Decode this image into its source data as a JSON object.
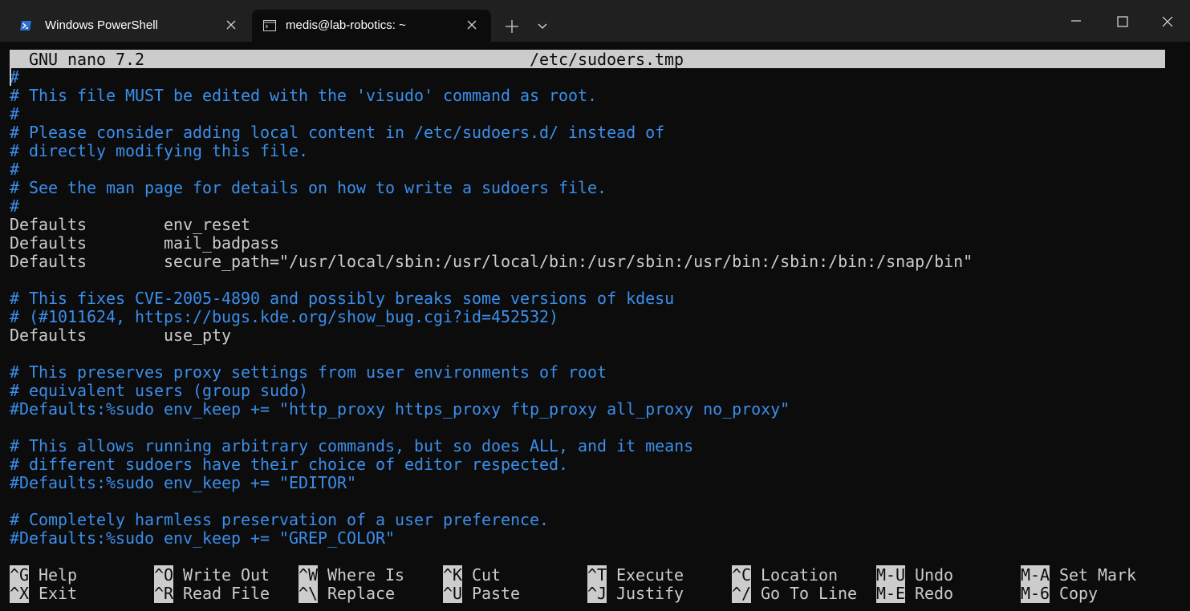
{
  "window": {
    "tabs": [
      {
        "label": "Windows PowerShell",
        "icon": "powershell-icon",
        "active": false
      },
      {
        "label": "medis@lab-robotics: ~",
        "icon": "terminal-icon",
        "active": true
      }
    ],
    "new_tab_icon": "plus-icon",
    "dropdown_icon": "chevron-down-icon",
    "controls": [
      "minimize-icon",
      "maximize-icon",
      "close-icon"
    ]
  },
  "editor": {
    "app": "GNU nano 7.2",
    "filename": "/etc/sudoers.tmp",
    "lines": [
      {
        "text": "#",
        "kind": "comment"
      },
      {
        "text": "# This file MUST be edited with the 'visudo' command as root.",
        "kind": "comment"
      },
      {
        "text": "#",
        "kind": "comment"
      },
      {
        "text": "# Please consider adding local content in /etc/sudoers.d/ instead of",
        "kind": "comment"
      },
      {
        "text": "# directly modifying this file.",
        "kind": "comment"
      },
      {
        "text": "#",
        "kind": "comment"
      },
      {
        "text": "# See the man page for details on how to write a sudoers file.",
        "kind": "comment"
      },
      {
        "text": "#",
        "kind": "comment"
      },
      {
        "text": "Defaults        env_reset",
        "kind": "normal"
      },
      {
        "text": "Defaults        mail_badpass",
        "kind": "normal"
      },
      {
        "text": "Defaults        secure_path=\"/usr/local/sbin:/usr/local/bin:/usr/sbin:/usr/bin:/sbin:/bin:/snap/bin\"",
        "kind": "normal"
      },
      {
        "text": "",
        "kind": "normal"
      },
      {
        "text": "# This fixes CVE-2005-4890 and possibly breaks some versions of kdesu",
        "kind": "comment"
      },
      {
        "text": "# (#1011624, https://bugs.kde.org/show_bug.cgi?id=452532)",
        "kind": "comment"
      },
      {
        "text": "Defaults        use_pty",
        "kind": "normal"
      },
      {
        "text": "",
        "kind": "normal"
      },
      {
        "text": "# This preserves proxy settings from user environments of root",
        "kind": "comment"
      },
      {
        "text": "# equivalent users (group sudo)",
        "kind": "comment"
      },
      {
        "text": "#Defaults:%sudo env_keep += \"http_proxy https_proxy ftp_proxy all_proxy no_proxy\"",
        "kind": "comment"
      },
      {
        "text": "",
        "kind": "normal"
      },
      {
        "text": "# This allows running arbitrary commands, but so does ALL, and it means",
        "kind": "comment"
      },
      {
        "text": "# different sudoers have their choice of editor respected.",
        "kind": "comment"
      },
      {
        "text": "#Defaults:%sudo env_keep += \"EDITOR\"",
        "kind": "comment"
      },
      {
        "text": "",
        "kind": "normal"
      },
      {
        "text": "# Completely harmless preservation of a user preference.",
        "kind": "comment"
      },
      {
        "text": "#Defaults:%sudo env_keep += \"GREP_COLOR\"",
        "kind": "comment"
      }
    ]
  },
  "shortcuts": [
    [
      {
        "key": "^G",
        "label": "Help"
      },
      {
        "key": "^X",
        "label": "Exit"
      }
    ],
    [
      {
        "key": "^O",
        "label": "Write Out"
      },
      {
        "key": "^R",
        "label": "Read File"
      }
    ],
    [
      {
        "key": "^W",
        "label": "Where Is"
      },
      {
        "key": "^\\",
        "label": "Replace"
      }
    ],
    [
      {
        "key": "^K",
        "label": "Cut"
      },
      {
        "key": "^U",
        "label": "Paste"
      }
    ],
    [
      {
        "key": "^T",
        "label": "Execute"
      },
      {
        "key": "^J",
        "label": "Justify"
      }
    ],
    [
      {
        "key": "^C",
        "label": "Location"
      },
      {
        "key": "^/",
        "label": "Go To Line"
      }
    ],
    [
      {
        "key": "M-U",
        "label": "Undo"
      },
      {
        "key": "M-E",
        "label": "Redo"
      }
    ],
    [
      {
        "key": "M-A",
        "label": "Set Mark"
      },
      {
        "key": "M-6",
        "label": "Copy"
      }
    ]
  ],
  "colors": {
    "background": "#0c0c0c",
    "titlebar": "#202020",
    "comment": "#3b8eea",
    "text": "#cccccc",
    "highlight_bg": "#cccccc"
  }
}
